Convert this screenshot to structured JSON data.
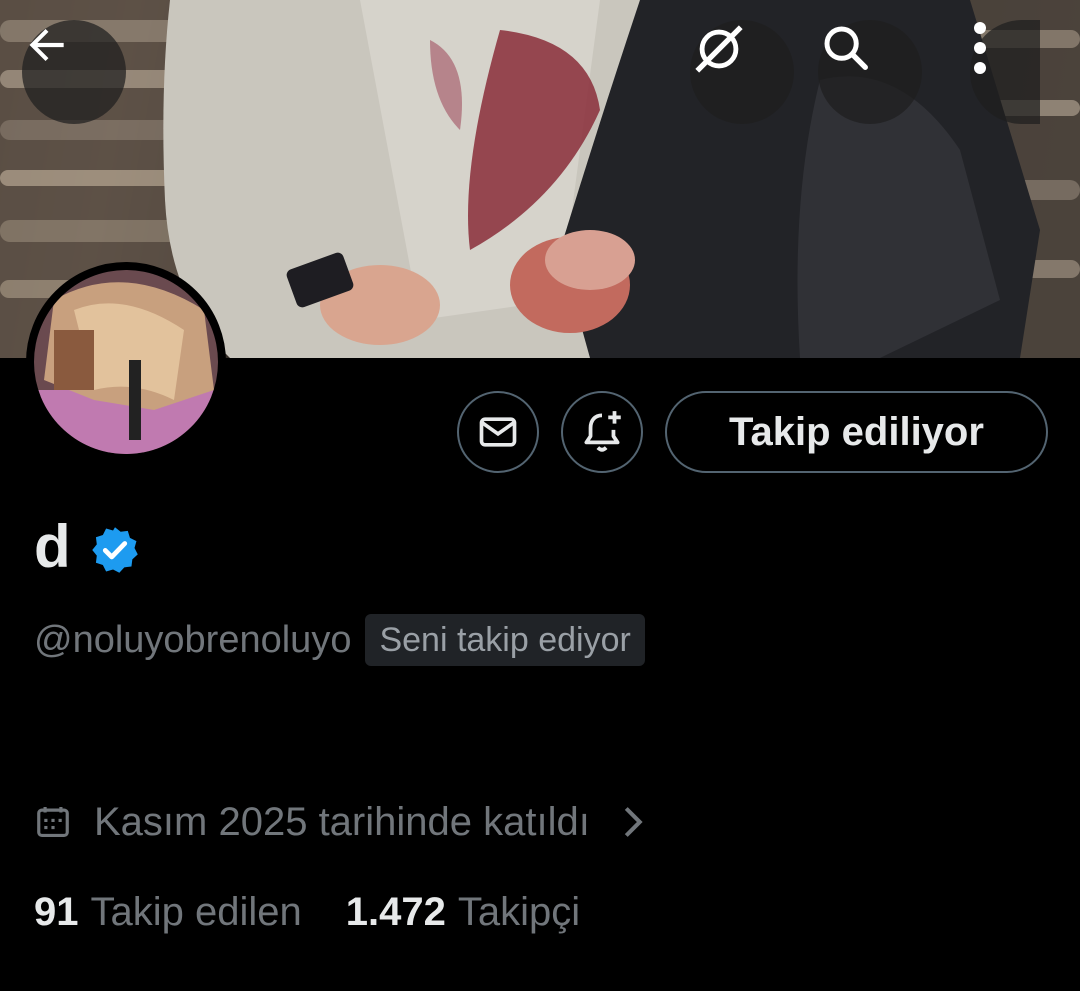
{
  "header": {
    "back_icon": "arrow-left-icon",
    "grok_icon": "grok-icon",
    "search_icon": "search-icon",
    "more_icon": "more-vertical-icon"
  },
  "profile": {
    "display_name": "d",
    "verified": true,
    "verified_color": "#1d9bf0",
    "handle": "@noluyobrenoluyo",
    "follows_you_label": "Seni takip ediyor",
    "joined_text": "Kasım 2025 tarihinde katıldı",
    "following_count": "91",
    "following_label": "Takip edilen",
    "followers_count": "1.472",
    "followers_label": "Takipçi"
  },
  "actions": {
    "message_icon": "mail-icon",
    "notify_icon": "bell-plus-icon",
    "follow_state_label": "Takip ediliyor"
  },
  "colors": {
    "background": "#000000",
    "text_primary": "#e7e9ea",
    "text_secondary": "#71767b",
    "border": "#536471"
  }
}
